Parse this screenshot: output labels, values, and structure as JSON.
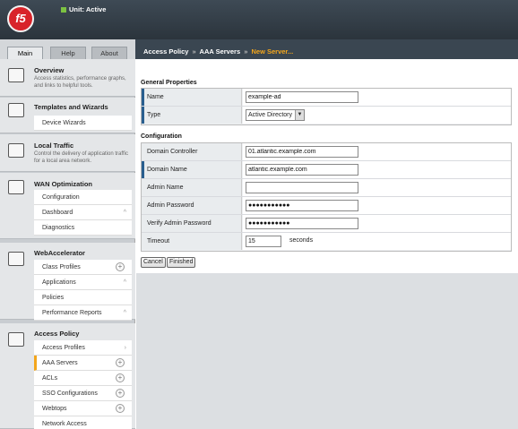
{
  "header": {
    "logo": "f5",
    "unit_status": "Unit: Active"
  },
  "tabs": [
    {
      "label": "Main"
    },
    {
      "label": "Help"
    },
    {
      "label": "About"
    }
  ],
  "breadcrumb": {
    "part1": "Access Policy",
    "part2": "AAA Servers",
    "current": "New Server...",
    "sep": "»"
  },
  "sidebar": {
    "overview": {
      "title": "Overview",
      "desc": "Access statistics, performance graphs, and links to helpful tools."
    },
    "templates": {
      "title": "Templates and Wizards",
      "items": [
        "Device Wizards"
      ]
    },
    "local_traffic": {
      "title": "Local Traffic",
      "desc": "Control the delivery of application traffic for a local area network."
    },
    "wan": {
      "title": "WAN Optimization",
      "items": [
        "Configuration",
        "Dashboard",
        "Diagnostics"
      ]
    },
    "webaccel": {
      "title": "WebAccelerator",
      "items": [
        "Class Profiles",
        "Applications",
        "Policies",
        "Performance Reports"
      ]
    },
    "access_policy": {
      "title": "Access Policy",
      "items": [
        "Access Profiles",
        "AAA Servers",
        "ACLs",
        "SSO Configurations",
        "Webtops",
        "Network Access"
      ]
    }
  },
  "general": {
    "heading": "General Properties",
    "name_label": "Name",
    "name_value": "example-ad",
    "type_label": "Type",
    "type_value": "Active Directory"
  },
  "config": {
    "heading": "Configuration",
    "dc_label": "Domain Controller",
    "dc_value": "01.atlantic.example.com",
    "dn_label": "Domain Name",
    "dn_value": "atlantic.example.com",
    "admin_name_label": "Admin Name",
    "admin_name_value": "",
    "admin_pw_label": "Admin Password",
    "admin_pw_value": "●●●●●●●●●●●",
    "verify_pw_label": "Verify Admin Password",
    "verify_pw_value": "●●●●●●●●●●●",
    "timeout_label": "Timeout",
    "timeout_value": "15",
    "timeout_unit": "seconds"
  },
  "buttons": {
    "cancel": "Cancel",
    "finished": "Finished"
  },
  "colors": {
    "accent_orange": "#f3a61c",
    "required_marker": "#2a5f8f",
    "header_bg": "#3a4651",
    "logo_red": "#d8232a"
  }
}
